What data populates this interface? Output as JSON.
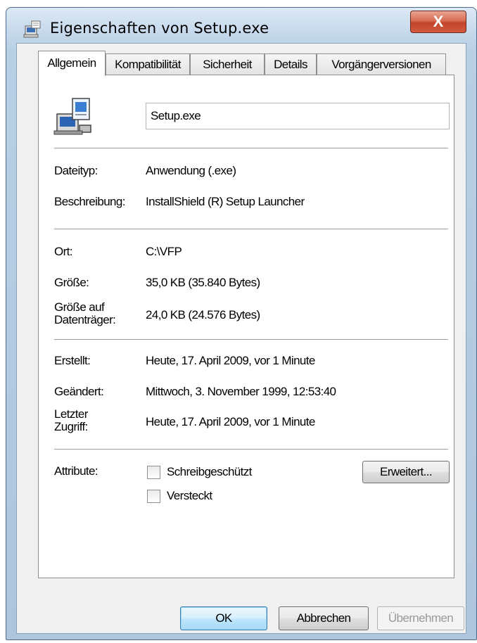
{
  "window": {
    "title": "Eigenschaften von Setup.exe",
    "close_label": "X",
    "app_icon": "properties-window-icon"
  },
  "tabs": [
    {
      "label": "Allgemein",
      "active": true
    },
    {
      "label": "Kompatibilität",
      "active": false
    },
    {
      "label": "Sicherheit",
      "active": false
    },
    {
      "label": "Details",
      "active": false
    },
    {
      "label": "Vorgängerversionen",
      "active": false
    }
  ],
  "general": {
    "file_icon": "setup-program-icon",
    "file_name": "Setup.exe",
    "type": {
      "label": "Dateityp:",
      "value": "Anwendung (.exe)"
    },
    "description": {
      "label": "Beschreibung:",
      "value": "InstallShield (R) Setup Launcher"
    },
    "location": {
      "label": "Ort:",
      "value": "C:\\VFP"
    },
    "size": {
      "label": "Größe:",
      "value": "35,0 KB (35.840 Bytes)"
    },
    "size_on_disk": {
      "label_line1": "Größe auf",
      "label_line2": "Datenträger:",
      "value": "24,0 KB (24.576 Bytes)"
    },
    "created": {
      "label": "Erstellt:",
      "value": "Heute, 17. April 2009, vor 1 Minute"
    },
    "modified": {
      "label": "Geändert:",
      "value": "Mittwoch, 3. November 1999, 12:53:40"
    },
    "accessed": {
      "label_line1": "Letzter",
      "label_line2": "Zugriff:",
      "value": "Heute, 17. April 2009, vor 1 Minute"
    },
    "attributes": {
      "label": "Attribute:",
      "readonly": {
        "label": "Schreibgeschützt",
        "checked": false
      },
      "hidden": {
        "label": "Versteckt",
        "checked": false
      },
      "advanced_label": "Erweitert..."
    }
  },
  "buttons": {
    "ok": "OK",
    "cancel": "Abbrechen",
    "apply": "Übernehmen"
  }
}
